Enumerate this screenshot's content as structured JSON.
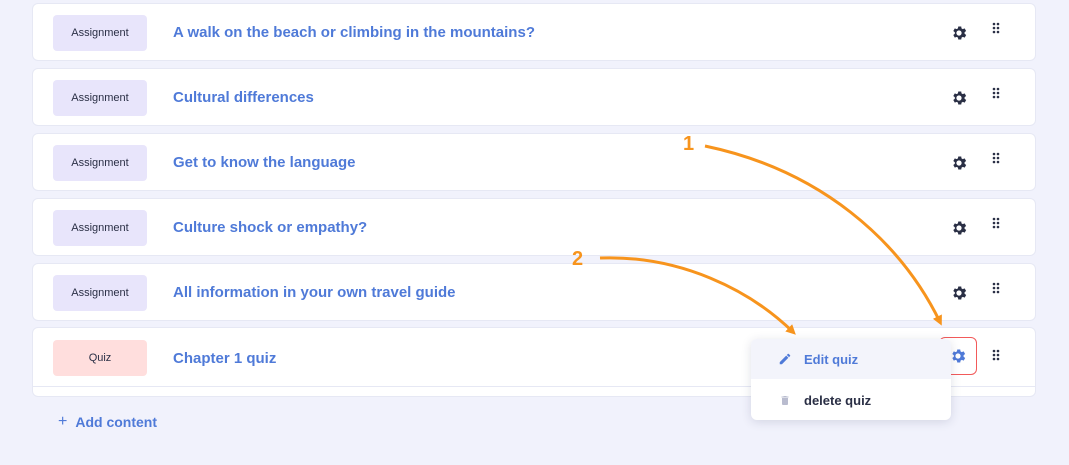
{
  "rows": [
    {
      "type": "Assignment",
      "title": "A walk on the beach or climbing in the mountains?"
    },
    {
      "type": "Assignment",
      "title": "Cultural differences"
    },
    {
      "type": "Assignment",
      "title": "Get to know the language"
    },
    {
      "type": "Assignment",
      "title": "Culture shock or empathy?"
    },
    {
      "type": "Assignment",
      "title": "All information in your own travel guide"
    },
    {
      "type": "Quiz",
      "title": "Chapter 1 quiz"
    }
  ],
  "menu": {
    "edit_label": "Edit quiz",
    "delete_label": "delete quiz"
  },
  "add_content_label": "Add content",
  "annotations": {
    "one": "1",
    "two": "2"
  },
  "colors": {
    "accent": "#4f7ad8",
    "assignment_badge": "#e8e5fb",
    "quiz_badge": "#ffdedd",
    "arrow": "#f7941d",
    "highlight_border": "#f25a5a"
  },
  "icons": {
    "settings": "gear-icon",
    "drag": "drag-handle-icon",
    "edit": "pencil-icon",
    "delete": "trash-icon",
    "add": "plus-icon"
  }
}
